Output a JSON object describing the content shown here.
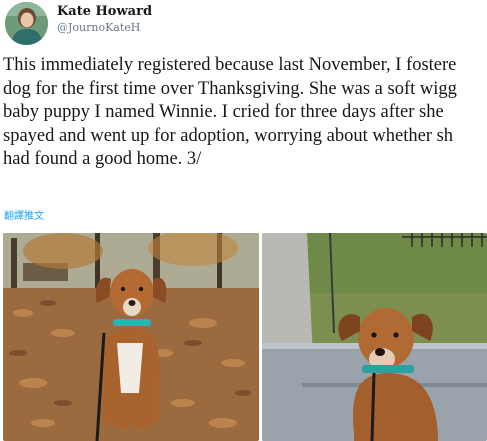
{
  "tweet": {
    "author_name": "Kate Howard",
    "author_handle": "@JournoKateH",
    "body_lines": [
      "This immediately registered because last November, I fostere",
      "dog for the first time over Thanksgiving. She was a soft wigg",
      "baby puppy I named Winnie. I cried for three days after she",
      "spayed and went up for adoption, worrying about whether sh",
      "had found a good home. 3/"
    ],
    "translate_label": "翻譯推文"
  },
  "media": {
    "photos": [
      {
        "description": "puppy-sitting-in-autumn-leaves"
      },
      {
        "description": "puppy-sitting-on-porch-steps"
      }
    ]
  },
  "colors": {
    "link": "#1da1f2",
    "handle": "#657786",
    "text": "#14171a"
  }
}
